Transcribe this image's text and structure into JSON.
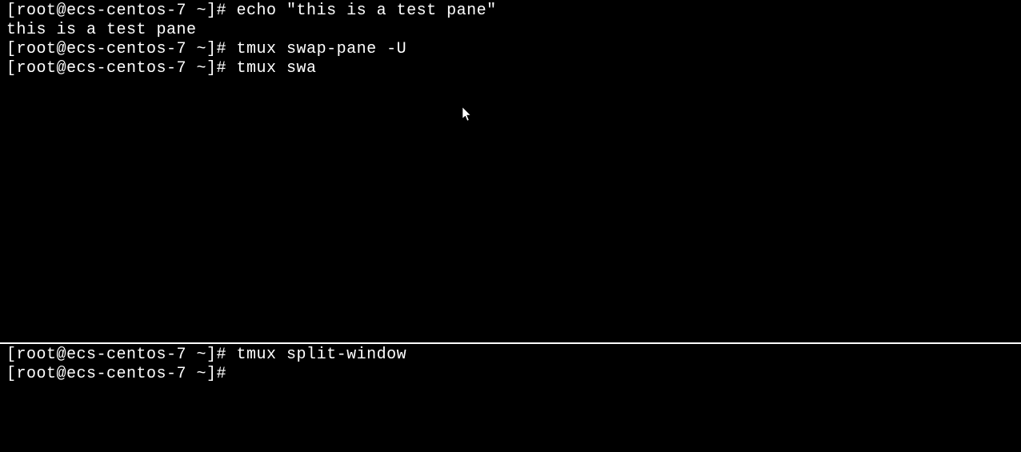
{
  "top_pane": {
    "lines": [
      {
        "prompt": "[root@ecs-centos-7 ~]# ",
        "command": "echo \"this is a test pane\""
      },
      {
        "output": "this is a test pane"
      },
      {
        "prompt": "[root@ecs-centos-7 ~]# ",
        "command": "tmux swap-pane -U"
      },
      {
        "prompt": "[root@ecs-centos-7 ~]# ",
        "command": "tmux swa"
      }
    ]
  },
  "bottom_pane": {
    "lines": [
      {
        "prompt": "[root@ecs-centos-7 ~]# ",
        "command": "tmux split-window"
      },
      {
        "prompt": "[root@ecs-centos-7 ~]# ",
        "command": ""
      }
    ]
  }
}
